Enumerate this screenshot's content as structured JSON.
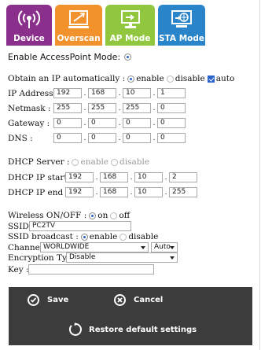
{
  "tabs": [
    {
      "label": "Device",
      "icon": "wireless-broadcast-icon",
      "color": "#8a2f8c"
    },
    {
      "label": "Overscan",
      "icon": "overscan-screen-icon",
      "color": "#f2922d"
    },
    {
      "label": "AP Mode",
      "icon": "access-point-monitor-icon",
      "color": "#91c63f"
    },
    {
      "label": "STA Mode",
      "icon": "station-globe-icon",
      "color": "#2a84c9"
    }
  ],
  "form": {
    "enable_ap_label": "Enable AccessPoint Mode:",
    "obtain_ip_label": "Obtain an IP automatically :",
    "enable_label": "enable",
    "disable_label": "disable",
    "auto_label": "auto",
    "ip_label": "IP Address :",
    "ip": [
      "192",
      "168",
      "10",
      "1"
    ],
    "netmask_label": "Netmask :",
    "netmask": [
      "255",
      "255",
      "255",
      "0"
    ],
    "gateway_label": "Gateway :",
    "gateway": [
      "0",
      "0",
      "0",
      "0"
    ],
    "dns_label": "DNS :",
    "dns": [
      "0",
      "0",
      "0",
      "0"
    ],
    "dhcp_server_label": "DHCP Server :",
    "dhcp_start_label": "DHCP IP start :",
    "dhcp_start": [
      "192",
      "168",
      "10",
      "2"
    ],
    "dhcp_end_label": "DHCP IP end :",
    "dhcp_end": [
      "192",
      "168",
      "10",
      "255"
    ],
    "wireless_label": "Wireless ON/OFF :",
    "on_label": "on",
    "off_label": "off",
    "ssid_label": "SSID :",
    "ssid_value": "PC2TV",
    "ssid_broadcast_label": "SSID broadcast :",
    "channel_label": "Channel :",
    "channel_value": "WORLDWIDE",
    "channel_auto_value": "Auto",
    "encryption_label": "Encryption Type :",
    "encryption_value": "Disable",
    "key_label": "Key :",
    "key_value": ""
  },
  "footer": {
    "save_label": "Save",
    "cancel_label": "Cancel",
    "restore_label": "Restore default settings"
  }
}
